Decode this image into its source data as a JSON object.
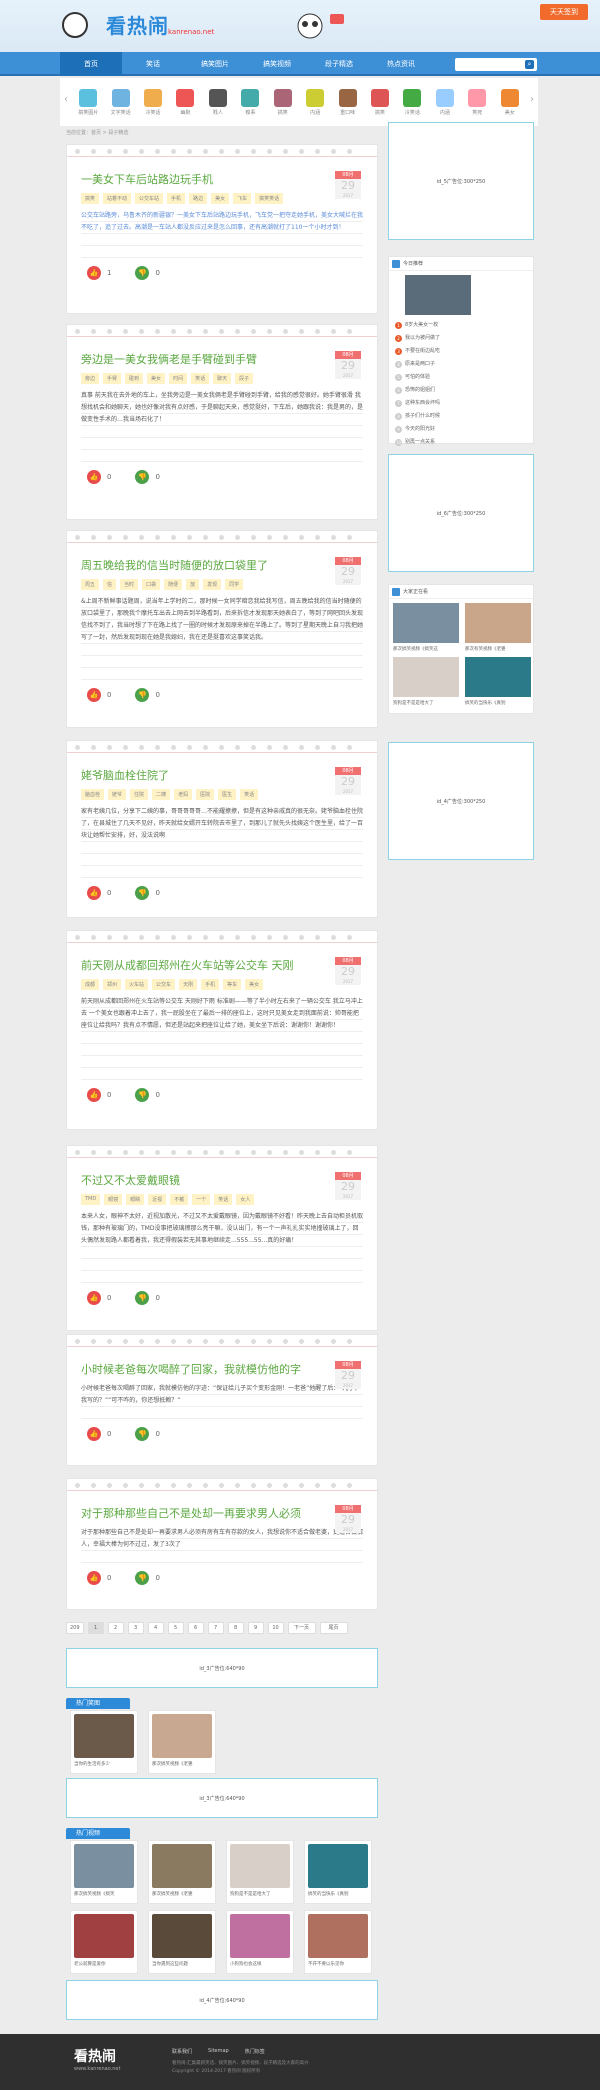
{
  "header": {
    "logo_text": "看热闹",
    "logo_url": "kanrenao.net",
    "signin": "天天签到"
  },
  "nav": [
    "首页",
    "笑话",
    "搞笑图片",
    "搞笑视频",
    "段子精选",
    "热点资讯"
  ],
  "categories": [
    "搞笑图片",
    "文字笑话",
    "冷笑话",
    "幽默",
    "贱人",
    "糗事",
    "搞笑",
    "内涵",
    "重口味",
    "搞笑",
    "冷笑话",
    "内涵",
    "笑死",
    "美女"
  ],
  "breadcrumb": "当前位置：首页 > 段子精选",
  "articles": [
    {
      "title": "一美女下车后站路边玩手机",
      "month": "08月",
      "day": "29",
      "year": "2017",
      "tags": [
        "搞笑",
        "站着不动",
        "公交车站",
        "手机",
        "路边",
        "美女",
        "飞车",
        "搞笑笑话"
      ],
      "body": "公交车站路旁，乌鲁木齐的新疆银？一美女下车后站路边玩手机，飞车党一把夺走她手机，美女大喊拦在我不吃了，追了过去。高潮是一车站人都没反应过来是怎么回事，还有高潮就打了110一个小时才到！",
      "up": "1",
      "down": "0"
    },
    {
      "title": "旁边是一美女我俩老是手臂碰到手臂",
      "month": "08月",
      "day": "29",
      "year": "2017",
      "tags": [
        "旁边",
        "手臂",
        "碰到",
        "美女",
        "时间",
        "笑话",
        "聊天",
        "段子"
      ],
      "body": "真事 前天我在去外地的车上，坐我旁边是一美女我俩老是手臂碰到手臂，给我的感觉很好。她手臂很滑 我想找机会和她聊天，她也好像对我有点好感，于是聊起天来，感觉挺好，下车后，她跟我说：我是男的，是做变性手术的…我当场石化了！",
      "up": "0",
      "down": "0"
    },
    {
      "title": "周五晚给我的信当时随便的放口袋里了",
      "month": "08月",
      "day": "29",
      "year": "2017",
      "tags": [
        "周五",
        "信",
        "当时",
        "口袋",
        "随便",
        "放",
        "发现",
        "同学"
      ],
      "body": "&上周不新鲜事话题周，说当年上学时的二，那时候一女同学暗恋我给我写信，周五晚给我的信当时随便的放口袋里了，那晚我个摩托车出去上网去到半路看到，后来拆信才发现那天她表白了，等到了网吧回头发现信找不到了，我当时想了下在路上找了一圈的时候才发现原来掉在半路上了。等到了星期天晚上自习我把她写了一封，然后发现到现在她是我媳妇，我在还是挺喜欢这事笑话我。",
      "up": "0",
      "down": "0"
    },
    {
      "title": "姥爷脑血栓住院了",
      "month": "08月",
      "day": "29",
      "year": "2017",
      "tags": [
        "脑血栓",
        "姥爷",
        "住院",
        "二姨",
        "老妈",
        "医院",
        "医生",
        "笑话"
      ],
      "body": "家有老姨几位，分享下二姨的事，哥哥哥哥哥…不能耀撩撩，但是有这种亲戚真的很无奈。姥爷脑血栓住院了，在县城住了几天不见好，昨天就给女婿开车转院去市里了，到那儿了就先头找姨这个医生里，给了一百块让她帮忙安排，好，没法说啊",
      "up": "0",
      "down": "0"
    },
    {
      "title": "前天刚从成都回郑州在火车站等公交车 天刚",
      "month": "08月",
      "day": "29",
      "year": "2017",
      "tags": [
        "成都",
        "郑州",
        "火车站",
        "公交车",
        "天刚",
        "手机",
        "等车",
        "美女"
      ],
      "body": "前天刚从成都回郑州在火车站等公交车 天刚好下雨 标准剧——等了半小时左右来了一辆公交车 我立马冲上去 一个美女也跟着冲上去了，我一屁股坐在了最后一排的座位上，这时只见美女走到我面前说：帅哥能把座位让给我吗？我有点不情愿，但还是站起来把座位让给了她，美女坐下后说：谢谢你！谢谢你！",
      "up": "0",
      "down": "0"
    },
    {
      "title": "不过又不太爱戴眼镜",
      "month": "08月",
      "day": "29",
      "year": "2017",
      "tags": [
        "TMD",
        "眼镜",
        "眼睛",
        "近视",
        "不戴",
        "一个",
        "笑话",
        "女人"
      ],
      "body": "本来人女，眼神不太好，近视加散光，不过又不太爱戴眼镜，因为戴眼镜不好看！昨天晚上去自动柜员机取钱，那种有玻璃门的，TMD没事把玻璃擦那么亮干嘛，没认出门，有一个一声礼扎实实地撞玻璃上了，回头偶然发现路人都看着我，我还得假装若无其事地继续走...555...55...真的好痛！",
      "up": "0",
      "down": "0"
    },
    {
      "title": "小时候老爸每次喝醉了回家，我就模仿他的字",
      "month": "08月",
      "day": "29",
      "year": "2017",
      "tags": [],
      "body": "小时候老爸每次喝醉了回家，我就模仿他的字迹：“保证给儿子买个变形金刚！一老爸”他醒了后：“儿子，我写的？”“可不咋的，你还想抵赖？”",
      "up": "0",
      "down": "0"
    },
    {
      "title": "对于那种那些自己不是处却一再要求男人必须",
      "month": "08月",
      "day": "29",
      "year": "2017",
      "tags": [],
      "body": "对于那种那些自己不是处却一再要求男人必须有房有车有存款的女人，我想说你不适合做老婆，更适合做情人，幸福大棒为何不过过，发了3次了",
      "up": "0",
      "down": "0"
    }
  ],
  "pager": [
    "209",
    "1",
    "2",
    "3",
    "4",
    "5",
    "6",
    "7",
    "8",
    "9",
    "10",
    "下一页",
    "尾页"
  ],
  "ads": {
    "side1": "id_5广告位:300*250",
    "side2": "id_6广告位:300*250",
    "side3": "id_4广告位:300*250",
    "main1": "id_3广告位:640*90",
    "main2": "id_3广告位:640*90",
    "main3": "id_4广告位:640*90"
  },
  "rank": {
    "title": "今日推荐",
    "items": [
      "8岁大美女一枚",
      "我以为被问做了",
      "不要在街边乱吃",
      "原来是两口子",
      "可怕的体验",
      "恐怖的姐姐们",
      "这种东西会坏吗",
      "孩子们什么时候",
      "今天的阳光好",
      "别再一点关系"
    ]
  },
  "side_pics": {
    "title": "大家正在看",
    "items": [
      "那次搞笑视频《搞笑这",
      "那次有笑视频《老婆",
      "狗狗是不是是哈大了",
      "搞笑的当快乐《真别"
    ]
  },
  "hot_pics": {
    "title": "热门笑图",
    "items": [
      "当你的生活有多少",
      "那次搞笑视频《老婆"
    ]
  },
  "hot_videos": {
    "title": "热门视频",
    "items": [
      "那次搞笑视频《搞笑",
      "那次搞笑视频《老婆",
      "狗狗是不是是哈大了",
      "搞笑的当快乐《真别",
      "老公就算是爱你",
      "当你遇到这些问题",
      "小狗狗也会这样",
      "不开不要以乐见你"
    ]
  },
  "footer": {
    "logo": "看热闹",
    "url": "www.kanrenao.net",
    "links": [
      "联系我们",
      "Sitemap",
      "热门标签"
    ],
    "copy1": "看热闹-汇集最新笑话、搞笑图片、搞笑视频、段子精选及大家的高兴",
    "copy2": "Copyright © 2014-2017 看热闹 版权所有"
  },
  "colors": {
    "nav": "#3d8fd6",
    "title": "#5ba840",
    "accent": "#f26b2c"
  }
}
